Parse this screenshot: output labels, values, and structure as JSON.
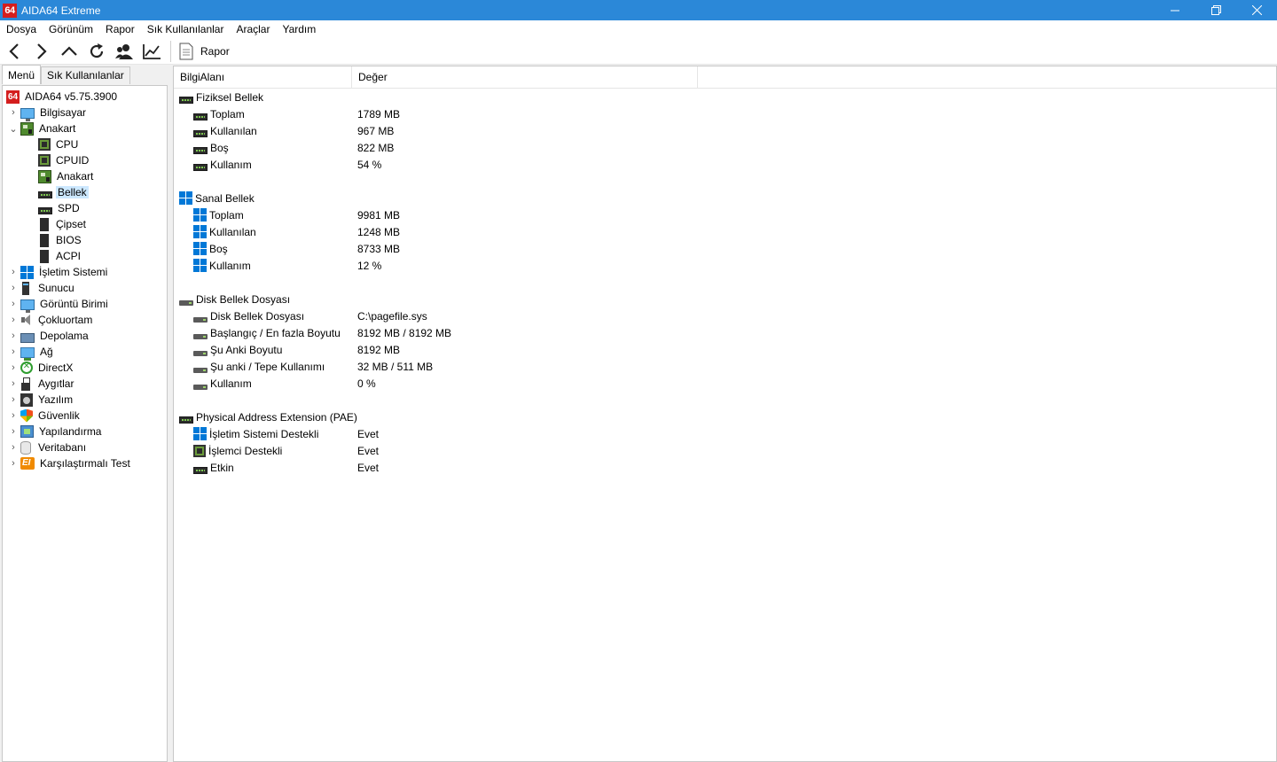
{
  "window": {
    "title": "AIDA64 Extreme",
    "logo_text": "64"
  },
  "menubar": [
    "Dosya",
    "Görünüm",
    "Rapor",
    "Sık Kullanılanlar",
    "Araçlar",
    "Yardım"
  ],
  "toolbar": {
    "report_label": "Rapor"
  },
  "left_tabs": [
    "Menü",
    "Sık Kullanılanlar"
  ],
  "tree": {
    "root": "AIDA64 v5.75.3900",
    "items": [
      {
        "label": "Bilgisayar",
        "icon": "computer-icon"
      },
      {
        "label": "Anakart",
        "icon": "motherboard-icon",
        "expanded": true
      },
      {
        "label": "CPU",
        "icon": "cpu-icon"
      },
      {
        "label": "CPUID",
        "icon": "cpu-icon"
      },
      {
        "label": "Anakart",
        "icon": "motherboard-icon"
      },
      {
        "label": "Bellek",
        "icon": "memory-icon",
        "selected": true
      },
      {
        "label": "SPD",
        "icon": "memory-icon"
      },
      {
        "label": "Çipset",
        "icon": "chip-icon"
      },
      {
        "label": "BIOS",
        "icon": "chip-icon"
      },
      {
        "label": "ACPI",
        "icon": "chip-icon"
      },
      {
        "label": "İşletim Sistemi",
        "icon": "windows-icon"
      },
      {
        "label": "Sunucu",
        "icon": "server-icon"
      },
      {
        "label": "Görüntü Birimi",
        "icon": "monitor-icon"
      },
      {
        "label": "Çokluortam",
        "icon": "speaker-icon"
      },
      {
        "label": "Depolama",
        "icon": "storage-icon"
      },
      {
        "label": "Ağ",
        "icon": "network-icon"
      },
      {
        "label": "DirectX",
        "icon": "xbox-icon"
      },
      {
        "label": "Aygıtlar",
        "icon": "usb-icon"
      },
      {
        "label": "Yazılım",
        "icon": "software-icon"
      },
      {
        "label": "Güvenlik",
        "icon": "shield-icon"
      },
      {
        "label": "Yapılandırma",
        "icon": "config-icon"
      },
      {
        "label": "Veritabanı",
        "icon": "database-icon"
      },
      {
        "label": "Karşılaştırmalı Test",
        "icon": "benchmark-icon"
      }
    ]
  },
  "columns": {
    "field": "BilgiAlanı",
    "value": "Değer"
  },
  "sections": [
    {
      "title": "Fiziksel Bellek",
      "icon": "memory-icon",
      "rows": [
        {
          "field": "Toplam",
          "value": "1789 MB",
          "icon": "memory-icon"
        },
        {
          "field": "Kullanılan",
          "value": "967 MB",
          "icon": "memory-icon"
        },
        {
          "field": "Boş",
          "value": "822 MB",
          "icon": "memory-icon"
        },
        {
          "field": "Kullanım",
          "value": "54 %",
          "icon": "memory-icon"
        }
      ]
    },
    {
      "title": "Sanal Bellek",
      "icon": "windows-icon",
      "rows": [
        {
          "field": "Toplam",
          "value": "9981 MB",
          "icon": "windows-icon"
        },
        {
          "field": "Kullanılan",
          "value": "1248 MB",
          "icon": "windows-icon"
        },
        {
          "field": "Boş",
          "value": "8733 MB",
          "icon": "windows-icon"
        },
        {
          "field": "Kullanım",
          "value": "12 %",
          "icon": "windows-icon"
        }
      ]
    },
    {
      "title": "Disk Bellek Dosyası",
      "icon": "disk-icon",
      "rows": [
        {
          "field": "Disk Bellek Dosyası",
          "value": "C:\\pagefile.sys",
          "icon": "disk-icon"
        },
        {
          "field": "Başlangıç / En fazla Boyutu",
          "value": "8192 MB / 8192 MB",
          "icon": "disk-icon"
        },
        {
          "field": "Şu Anki Boyutu",
          "value": "8192 MB",
          "icon": "disk-icon"
        },
        {
          "field": "Şu anki / Tepe Kullanımı",
          "value": "32 MB / 511 MB",
          "icon": "disk-icon"
        },
        {
          "field": "Kullanım",
          "value": "0 %",
          "icon": "disk-icon"
        }
      ]
    },
    {
      "title": "Physical Address Extension (PAE)",
      "icon": "memory-icon",
      "rows": [
        {
          "field": "İşletim Sistemi Destekli",
          "value": "Evet",
          "icon": "windows-icon"
        },
        {
          "field": "İşlemci Destekli",
          "value": "Evet",
          "icon": "cpu-icon"
        },
        {
          "field": "Etkin",
          "value": "Evet",
          "icon": "memory-icon"
        }
      ]
    }
  ],
  "colors": {
    "titlebar": "#2b88d8",
    "selection": "#cce8ff"
  }
}
